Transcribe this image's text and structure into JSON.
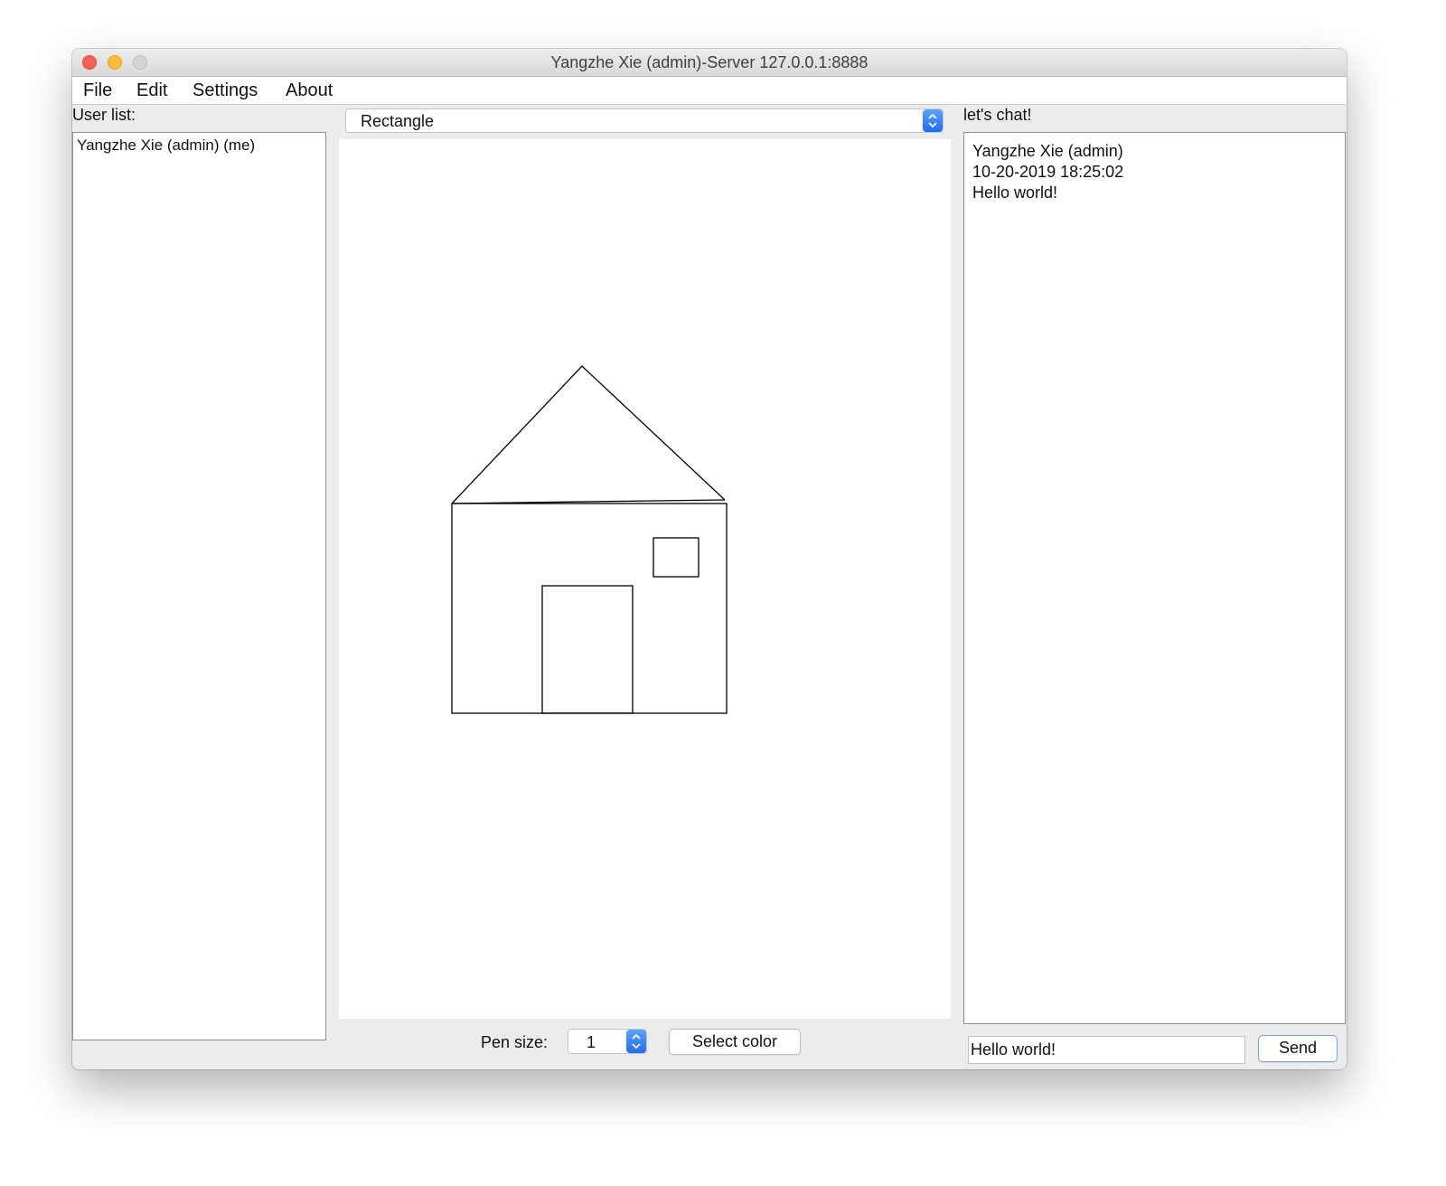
{
  "window": {
    "title": "Yangzhe Xie (admin)-Server 127.0.0.1:8888"
  },
  "menu": {
    "items": [
      "File",
      "Edit",
      "Settings",
      "About"
    ]
  },
  "user_list": {
    "label": "User list:",
    "users": [
      "Yangzhe Xie (admin) (me)"
    ]
  },
  "toolbar": {
    "shape_selected": "Rectangle"
  },
  "chat": {
    "label": "let's chat!",
    "messages": [
      {
        "sender": "Yangzhe Xie (admin)",
        "time": "10-20-2019 18:25:02",
        "text": "Hello world!"
      }
    ],
    "input_value": "Hello world!",
    "send_label": "Send"
  },
  "controls": {
    "pen_label": "Pen size:",
    "pen_value": "1",
    "color_button": "Select color"
  },
  "colors": {
    "accent": "#1d6ff2",
    "stroke": "#000000",
    "background": "#ececec"
  }
}
